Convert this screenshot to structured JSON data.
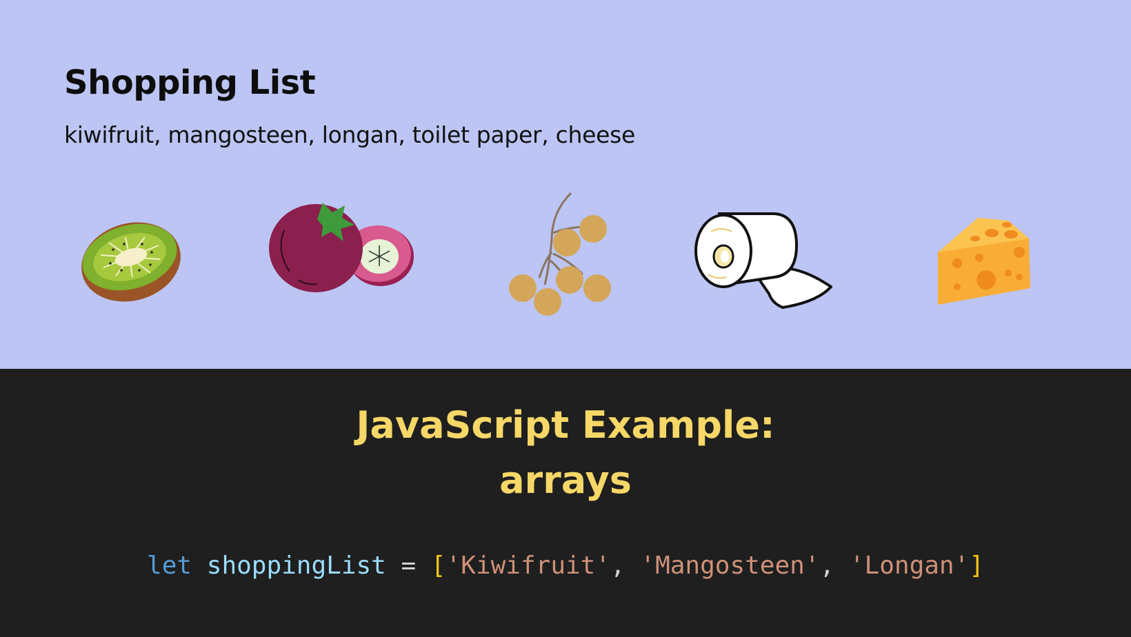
{
  "slide": {
    "title": "Shopping List",
    "items_text": "kiwifruit, mangosteen, longan, toilet paper, cheese",
    "illustrations": [
      {
        "icon": "kiwi-icon"
      },
      {
        "icon": "mangosteen-icon"
      },
      {
        "icon": "longan-icon"
      },
      {
        "icon": "toilet-paper-icon"
      },
      {
        "icon": "cheese-icon"
      }
    ],
    "heading_line1": "JavaScript Example:",
    "heading_line2": "arrays",
    "code": {
      "keyword": "let",
      "variable": "shoppingList",
      "operator": "=",
      "open_bracket": "[",
      "close_bracket": "]",
      "separator": ",",
      "strings": [
        "'Kiwifruit'",
        "'Mangosteen'",
        "'Longan'"
      ]
    }
  },
  "colors": {
    "top_background": "#bcc5f3",
    "bottom_background": "#1f1f1f",
    "heading": "#f6d767",
    "code_keyword": "#569cd6",
    "code_variable": "#9cdcfe",
    "code_string": "#ce9178",
    "code_bracket": "#f5c518"
  }
}
